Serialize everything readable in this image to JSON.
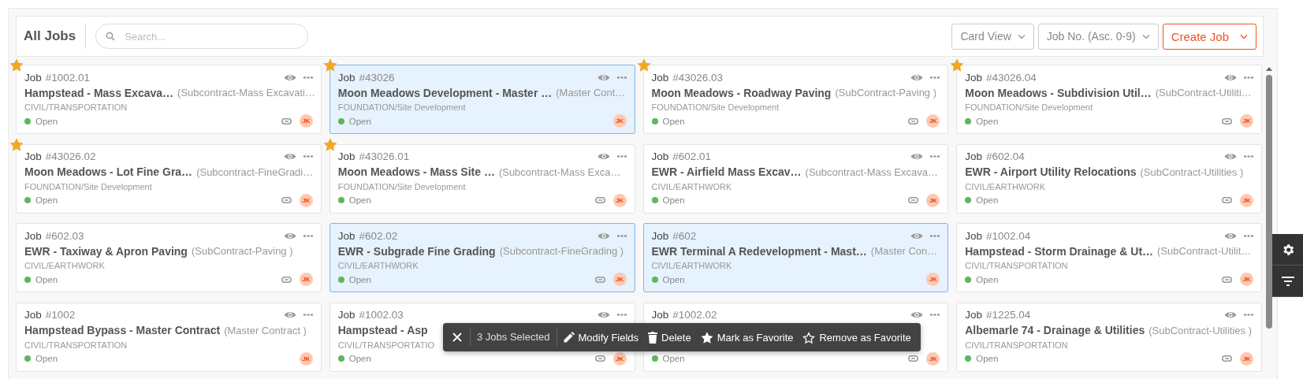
{
  "header": {
    "title": "All Jobs",
    "search": {
      "placeholder": "Search..."
    },
    "view_select": "Card View",
    "sort_select": "Job No. (Asc. 0-9)",
    "create_button": "Create Job"
  },
  "jobs": [
    {
      "label": "Job",
      "number": "#1002.01",
      "title": "Hampstead - Mass Excava…",
      "contract": "(Subcontract-Mass Excavati…",
      "category": "CIVIL/TRANSPORTATION",
      "status": "Open",
      "favorite": true,
      "selected": false,
      "linked": true,
      "assignee": "JK"
    },
    {
      "label": "Job",
      "number": "#43026",
      "title": "Moon Meadows Development - Master …",
      "contract": "(Master Cont…",
      "category": "FOUNDATION/Site Development",
      "status": "Open",
      "favorite": true,
      "selected": true,
      "linked": false,
      "assignee": "JK"
    },
    {
      "label": "Job",
      "number": "#43026.03",
      "title": "Moon Meadows - Roadway Paving",
      "contract": "(SubContract-Paving )",
      "category": "FOUNDATION/Site Development",
      "status": "Open",
      "favorite": true,
      "selected": false,
      "linked": true,
      "assignee": "JK"
    },
    {
      "label": "Job",
      "number": "#43026.04",
      "title": "Moon Meadows - Subdivision Util…",
      "contract": "(SubContract-Utiliti…",
      "category": "FOUNDATION/Site Development",
      "status": "Open",
      "favorite": true,
      "selected": false,
      "linked": true,
      "assignee": "JK"
    },
    {
      "label": "Job",
      "number": "#43026.02",
      "title": "Moon Meadows - Lot Fine Gra…",
      "contract": "(Subcontract-FineGradi…",
      "category": "FOUNDATION/Site Development",
      "status": "Open",
      "favorite": true,
      "selected": false,
      "linked": true,
      "assignee": "JK"
    },
    {
      "label": "Job",
      "number": "#43026.01",
      "title": "Moon Meadows - Mass Site …",
      "contract": "(Subcontract-Mass Exca…",
      "category": "FOUNDATION/Site Development",
      "status": "Open",
      "favorite": true,
      "selected": false,
      "linked": true,
      "assignee": "JK"
    },
    {
      "label": "Job",
      "number": "#602.01",
      "title": "EWR - Airfield Mass Excav…",
      "contract": "(Subcontract-Mass Excava…",
      "category": "CIVIL/EARTHWORK",
      "status": "Open",
      "favorite": false,
      "selected": false,
      "linked": true,
      "assignee": "JK"
    },
    {
      "label": "Job",
      "number": "#602.04",
      "title": "EWR - Airport Utility Relocations",
      "contract": "(SubContract-Utilities )",
      "category": "CIVIL/EARTHWORK",
      "status": "Open",
      "favorite": false,
      "selected": false,
      "linked": true,
      "assignee": "JK"
    },
    {
      "label": "Job",
      "number": "#602.03",
      "title": "EWR - Taxiway & Apron Paving",
      "contract": "(SubContract-Paving )",
      "category": "CIVIL/EARTHWORK",
      "status": "Open",
      "favorite": false,
      "selected": false,
      "linked": true,
      "assignee": "JK"
    },
    {
      "label": "Job",
      "number": "#602.02",
      "title": "EWR - Subgrade Fine Grading",
      "contract": "(Subcontract-FineGrading )",
      "category": "CIVIL/EARTHWORK",
      "status": "Open",
      "favorite": false,
      "selected": true,
      "linked": true,
      "assignee": "JK"
    },
    {
      "label": "Job",
      "number": "#602",
      "title": "EWR Terminal A Redevelopment - Mast…",
      "contract": "(Master Con…",
      "category": "CIVIL/EARTHWORK",
      "status": "Open",
      "favorite": false,
      "selected": true,
      "linked": false,
      "assignee": "JK"
    },
    {
      "label": "Job",
      "number": "#1002.04",
      "title": "Hampstead - Storm Drainage & Ut…",
      "contract": "(SubContract-Utilit…",
      "category": "CIVIL/TRANSPORTATION",
      "status": "Open",
      "favorite": false,
      "selected": false,
      "linked": true,
      "assignee": "JK"
    },
    {
      "label": "Job",
      "number": "#1002",
      "title": "Hampstead Bypass - Master Contract",
      "contract": "(Master Contract )",
      "category": "CIVIL/TRANSPORTATION",
      "status": "Open",
      "favorite": false,
      "selected": false,
      "linked": false,
      "assignee": "JK"
    },
    {
      "label": "Job",
      "number": "#1002.03",
      "title": "Hampstead - Asp",
      "category": "CIVIL/TRANSPORTATIO",
      "status": "Open",
      "favorite": false,
      "selected": false,
      "linked": true,
      "assignee": "JK"
    },
    {
      "label": "Job",
      "number": "#1002.02",
      "status": "Open",
      "favorite": false,
      "selected": false,
      "linked": true,
      "assignee": "JK"
    },
    {
      "label": "Job",
      "number": "#1225.04",
      "title": "Albemarle 74 - Drainage & Utilities",
      "contract": "(SubContract-Utilities )",
      "category": "CIVIL/TRANSPORTATION",
      "status": "Open",
      "favorite": false,
      "selected": false,
      "linked": true,
      "assignee": "JK"
    }
  ],
  "selection_bar": {
    "count": "3 Jobs Selected",
    "actions": [
      {
        "kind": "edit",
        "label": "Modify Fields"
      },
      {
        "kind": "delete",
        "label": "Delete"
      },
      {
        "kind": "favorite",
        "label": "Mark as Favorite"
      },
      {
        "kind": "unfavorite",
        "label": "Remove as Favorite"
      }
    ]
  }
}
